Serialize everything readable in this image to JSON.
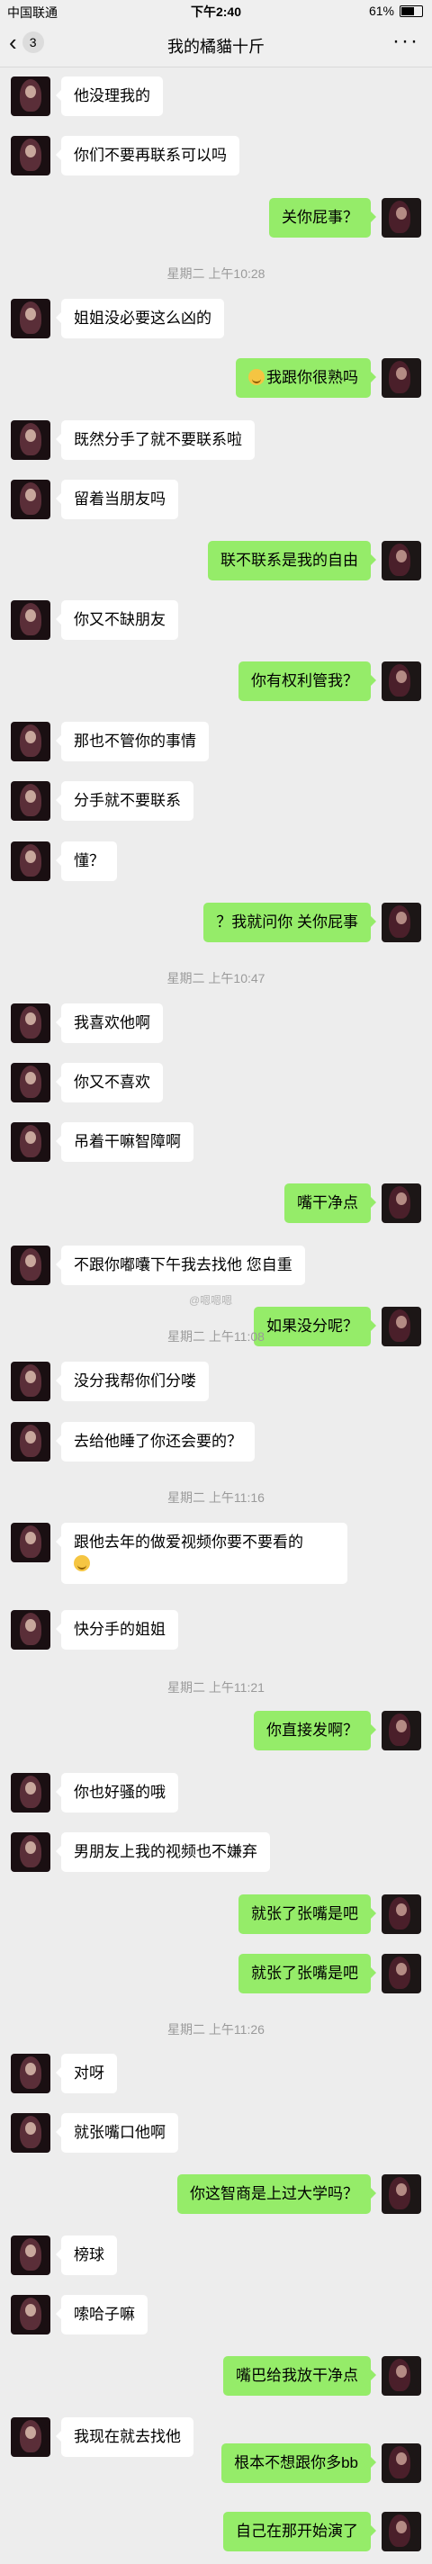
{
  "status": {
    "carrier": "中国联通",
    "time": "下午2:40",
    "battery": "61%"
  },
  "nav": {
    "back_count": "3",
    "title": "我的橘貓十斤",
    "more": "···"
  },
  "messages": [
    {
      "side": "left",
      "text": "他没理我的"
    },
    {
      "side": "left",
      "text": "你们不要再联系可以吗"
    },
    {
      "side": "me",
      "text": "关你屁事？"
    },
    {
      "type": "time",
      "text": "星期二 上午10:28"
    },
    {
      "side": "left",
      "text": "姐姐没必要这么凶的"
    },
    {
      "side": "me",
      "text": "我跟你很熟吗"
    },
    {
      "side": "left",
      "text": "既然分手了就不要联系啦"
    },
    {
      "side": "left",
      "text": "留着当朋友吗"
    },
    {
      "side": "me",
      "text": "联不联系是我的自由"
    },
    {
      "side": "left",
      "text": "你又不缺朋友"
    },
    {
      "side": "me",
      "text": "你有权利管我？"
    },
    {
      "side": "left",
      "text": "那也不管你的事情"
    },
    {
      "side": "left",
      "text": "分手就不要联系"
    },
    {
      "side": "left",
      "text": "懂？"
    },
    {
      "side": "me",
      "text": "？我就问你 关你屁事"
    },
    {
      "type": "time",
      "text": "星期二 上午10:47"
    },
    {
      "side": "left",
      "text": "我喜欢他啊"
    },
    {
      "side": "left",
      "text": "你又不喜欢"
    },
    {
      "side": "left",
      "text": "吊着干嘛智障啊"
    },
    {
      "side": "me",
      "text": "嘴干净点"
    },
    {
      "side": "left",
      "text": "不跟你嘟囔下午我去找他 您自重"
    },
    {
      "type": "watermark",
      "text": "@嗯嗯嗯"
    },
    {
      "side": "me",
      "text": "如果没分呢？"
    },
    {
      "type": "time",
      "text": "星期二 上午11:08"
    },
    {
      "side": "left",
      "text": "没分我帮你们分喽"
    },
    {
      "side": "left",
      "text": "去给他睡了你还会要的？"
    },
    {
      "type": "time",
      "text": "星期二 上午11:16"
    },
    {
      "side": "left",
      "text": "跟他去年的做爱视频你要不要看的"
    },
    {
      "side": "left",
      "text": "快分手的姐姐"
    },
    {
      "type": "time",
      "text": "星期二 上午11:21"
    },
    {
      "side": "me",
      "text": "你直接发啊？"
    },
    {
      "side": "left",
      "text": "你也好骚的哦"
    },
    {
      "side": "left",
      "text": "男朋友上我的视频也不嫌弃"
    },
    {
      "side": "me",
      "text": "就张了张嘴是吧"
    },
    {
      "side": "me",
      "text": "就张了张嘴是吧"
    },
    {
      "type": "time",
      "text": "星期二 上午11:26"
    },
    {
      "side": "left",
      "text": "对呀"
    },
    {
      "side": "left",
      "text": "就张嘴口他啊"
    },
    {
      "side": "me",
      "text": "你这智商是上过大学吗？"
    },
    {
      "side": "left",
      "text": "榜球"
    },
    {
      "side": "left",
      "text": "嗦哈子嘛"
    },
    {
      "side": "me",
      "text": "嘴巴给我放干净点"
    },
    {
      "side": "left",
      "text": "我现在就去找他"
    },
    {
      "side": "me",
      "text": "根本不想跟你多bb"
    },
    {
      "side": "me",
      "text": "自己在那开始演了"
    }
  ]
}
